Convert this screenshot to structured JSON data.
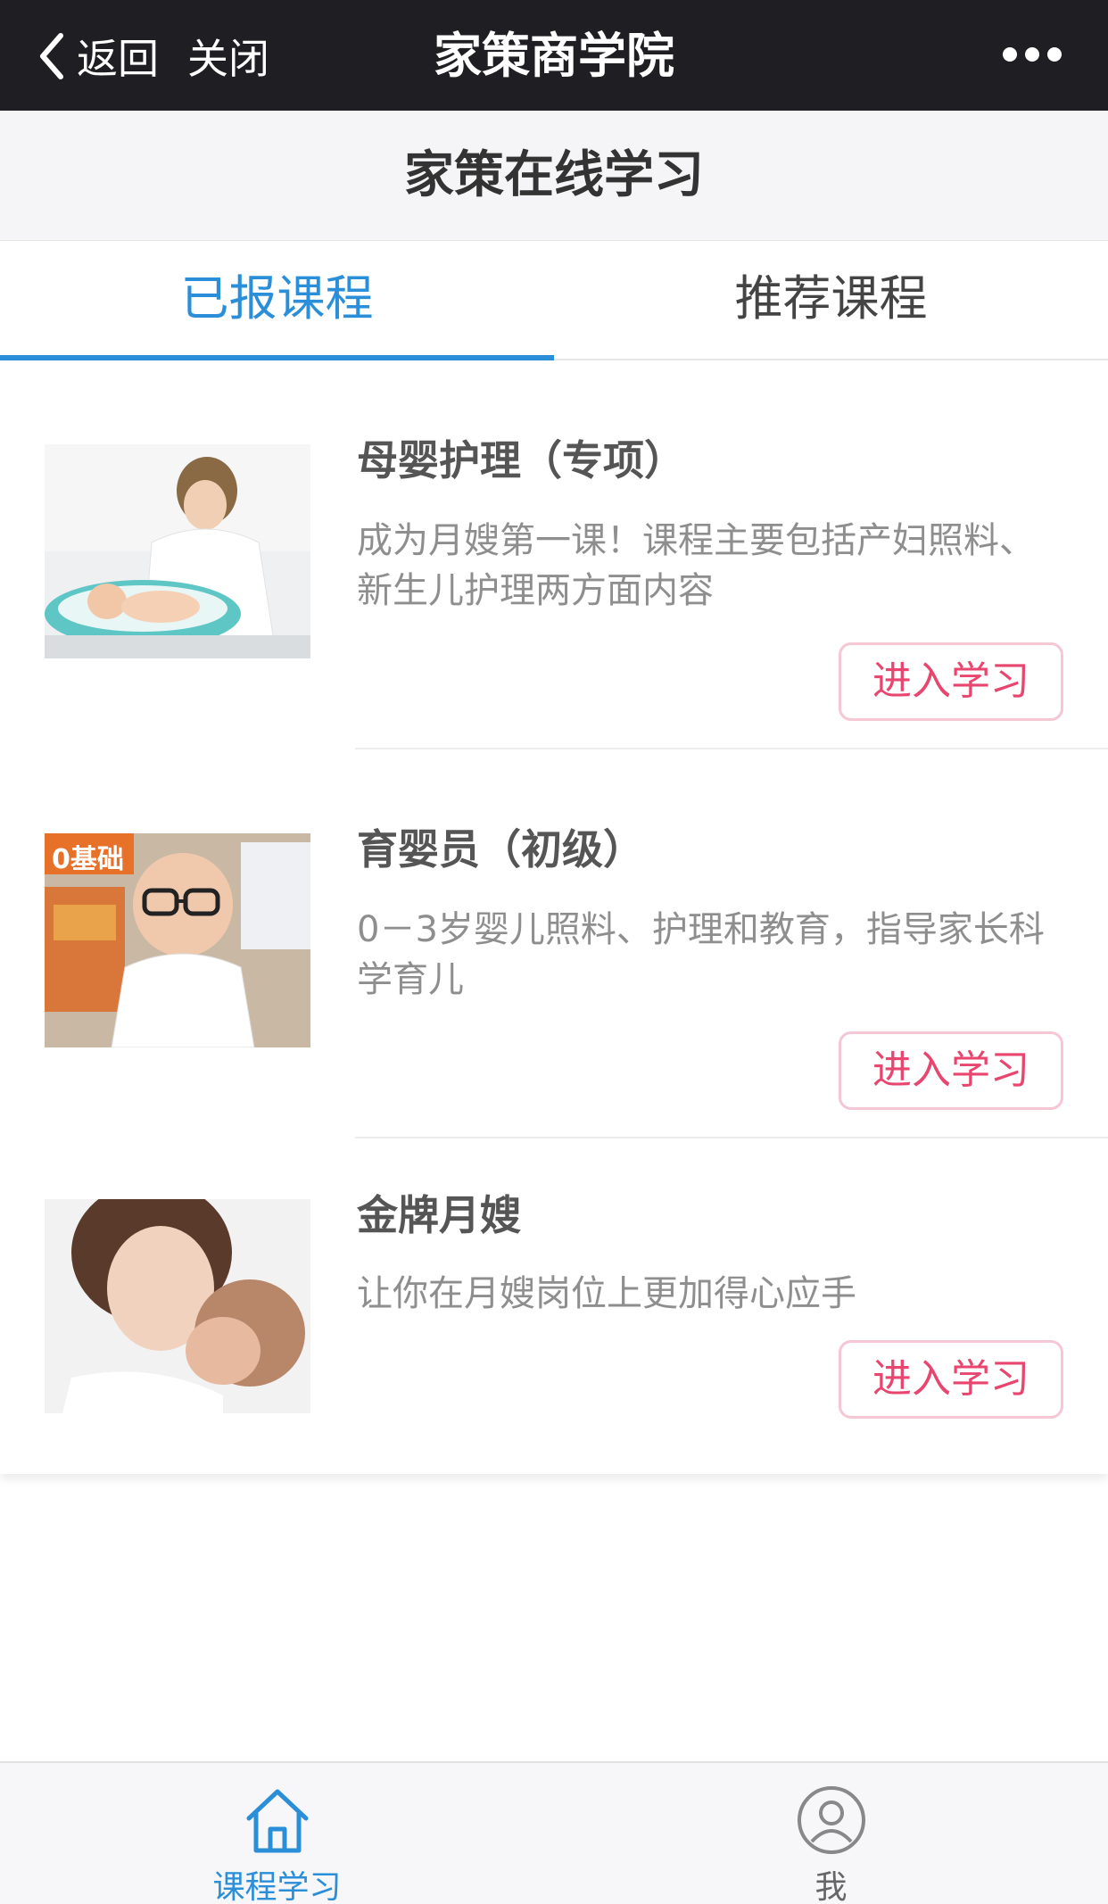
{
  "navbar": {
    "back_label": "返回",
    "close_label": "关闭",
    "title": "家策商学院"
  },
  "header": {
    "title": "家策在线学习"
  },
  "tabs": [
    {
      "label": "已报课程",
      "active": true
    },
    {
      "label": "推荐课程",
      "active": false
    }
  ],
  "courses": [
    {
      "title": "母婴护理（专项）",
      "description": "成为月嫂第一课！课程主要包括产妇照料、新生儿护理两方面内容",
      "button": "进入学习"
    },
    {
      "title": "育婴员（初级）",
      "description": "0－3岁婴儿照料、护理和教育，指导家长科学育儿",
      "badge": "0基础",
      "button": "进入学习"
    },
    {
      "title": "金牌月嫂",
      "description": "让你在月嫂岗位上更加得心应手",
      "button": "进入学习"
    }
  ],
  "tabbar": [
    {
      "label": "课程学习",
      "icon": "home-icon",
      "active": true
    },
    {
      "label": "我",
      "icon": "user-icon",
      "active": false
    }
  ],
  "colors": {
    "accent": "#2a8fd8",
    "button_text": "#e8456f",
    "button_border": "#f5c6d3",
    "navbar_bg": "#1f1f23"
  }
}
